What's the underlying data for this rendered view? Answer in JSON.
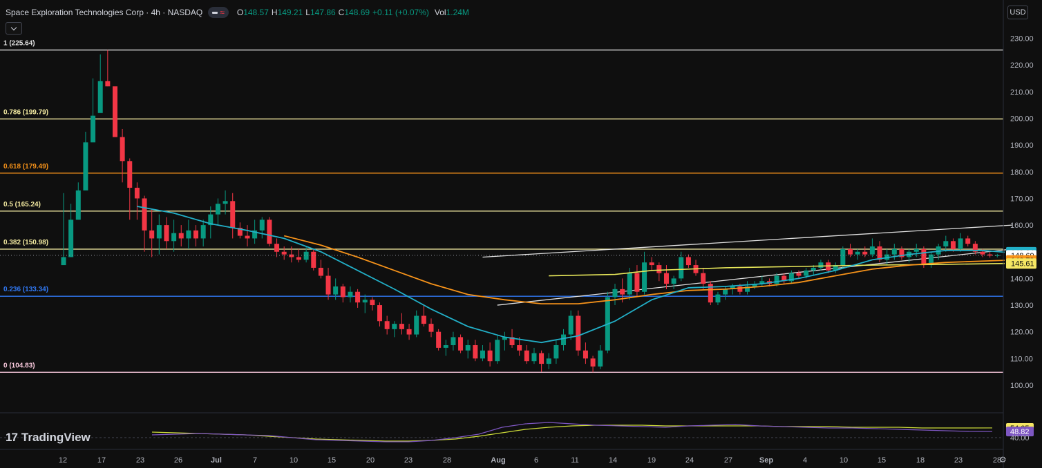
{
  "header": {
    "symbol": "Space Exploration Technologies Corp · 4h · NASDAQ",
    "open_label": "O",
    "open": "148.57",
    "high_label": "H",
    "high": "149.21",
    "low_label": "L",
    "low": "147.86",
    "close_label": "C",
    "close": "148.69",
    "change": "+0.11 (+0.07%)",
    "vol_label": "Vol",
    "volume": "1.24M"
  },
  "currency": "USD",
  "branding": {
    "logo": "17",
    "name": "TradingView"
  },
  "icons": {
    "collapse": "chevron-down-icon",
    "settings": "gear-icon",
    "indicator": "wave-icon",
    "series": "dash-icon"
  },
  "colors": {
    "up": "#089981",
    "down": "#f23645",
    "ema_fast": "#22b0c8",
    "ema_slow": "#f7931a",
    "sma": "#e8e85a",
    "rsi": "#7e57c2",
    "rsi_ma": "#cddc39"
  },
  "chart_data": {
    "type": "candlestick",
    "timeframe": "4h",
    "y_axis": {
      "min": 100,
      "max": 230,
      "ticks": [
        230,
        220,
        210,
        200,
        190,
        180,
        170,
        160,
        150,
        140,
        130,
        120,
        110,
        100
      ]
    },
    "x_axis": {
      "ticks": [
        "12",
        "17",
        "23",
        "26",
        "Jul",
        "7",
        "10",
        "15",
        "20",
        "23",
        "28",
        "Aug",
        "6",
        "11",
        "14",
        "19",
        "24",
        "27",
        "Sep",
        "4",
        "10",
        "15",
        "18",
        "23",
        "28"
      ]
    },
    "fib_levels": [
      {
        "label": "1 (225.64)",
        "value": 225.64,
        "color": "#e0e0e0"
      },
      {
        "label": "0.786 (199.79)",
        "value": 199.79,
        "color": "#f2e9a0"
      },
      {
        "label": "0.618 (179.49)",
        "value": 179.49,
        "color": "#f7931a"
      },
      {
        "label": "0.5 (165.24)",
        "value": 165.24,
        "color": "#f2e9a0"
      },
      {
        "label": "0.382 (150.98)",
        "value": 150.98,
        "color": "#f2e9a0"
      },
      {
        "label": "0.236 (133.34)",
        "value": 133.34,
        "color": "#3179f5"
      },
      {
        "label": "0 (104.83)",
        "value": 104.83,
        "color": "#f8c8dc"
      }
    ],
    "price_labels": [
      {
        "value": 149.84,
        "text": "149.84",
        "bg": "#22b0c8",
        "fg": "#0f0f0f"
      },
      {
        "value": 148.69,
        "text": "148.69",
        "bg": "#ffffff",
        "fg": "#0f0f0f"
      },
      {
        "value": 146.79,
        "text": "146.79",
        "bg": "#f7931a",
        "fg": "#0f0f0f"
      },
      {
        "value": 145.61,
        "text": "145.61",
        "bg": "#f5e663",
        "fg": "#0f0f0f"
      }
    ],
    "last_price": 148.69,
    "candles": [
      [
        145.0,
        172.0,
        148.0,
        148.0
      ],
      [
        148.0,
        168.0,
        148.0,
        162.0
      ],
      [
        162.0,
        176.0,
        165.0,
        173.0
      ],
      [
        173.0,
        195.0,
        175.0,
        191.0
      ],
      [
        191.0,
        215.0,
        200.0,
        201.0
      ],
      [
        202.0,
        224.0,
        208.0,
        214.0
      ],
      [
        214.0,
        225.64,
        212.0,
        212.0
      ],
      [
        212.0,
        210.0,
        193.0,
        193.0
      ],
      [
        193.0,
        196.0,
        176.0,
        184.0
      ],
      [
        184.0,
        185.0,
        162.0,
        174.0
      ],
      [
        174.0,
        176.0,
        162.0,
        170.0
      ],
      [
        170.0,
        171.0,
        150.0,
        158.0
      ],
      [
        158.0,
        166.0,
        148.0,
        155.0
      ],
      [
        155.0,
        164.0,
        149.0,
        160.0
      ],
      [
        160.0,
        163.0,
        151.0,
        154.0
      ],
      [
        154.0,
        162.0,
        150.0,
        157.0
      ],
      [
        157.0,
        160.0,
        152.0,
        155.0
      ],
      [
        155.0,
        162.0,
        151.0,
        158.0
      ],
      [
        158.0,
        160.0,
        152.0,
        155.0
      ],
      [
        155.0,
        162.0,
        152.0,
        160.0
      ],
      [
        160.0,
        167.0,
        155.0,
        164.0
      ],
      [
        164.0,
        170.0,
        160.0,
        168.0
      ],
      [
        168.0,
        173.0,
        164.0,
        169.0
      ],
      [
        169.0,
        172.0,
        155.0,
        159.0
      ],
      [
        159.0,
        161.0,
        155.0,
        156.0
      ],
      [
        156.0,
        160.0,
        152.0,
        155.0
      ],
      [
        155.0,
        162.0,
        153.0,
        158.0
      ],
      [
        158.0,
        163.0,
        155.0,
        162.0
      ],
      [
        162.0,
        163.0,
        152.0,
        153.0
      ],
      [
        153.0,
        155.0,
        148.0,
        150.0
      ],
      [
        150.0,
        152.0,
        147.0,
        149.0
      ],
      [
        149.0,
        152.0,
        146.0,
        148.0
      ],
      [
        148.0,
        151.0,
        146.0,
        147.0
      ],
      [
        147.0,
        152.0,
        146.0,
        150.0
      ],
      [
        150.0,
        151.0,
        143.0,
        144.0
      ],
      [
        144.0,
        147.0,
        140.0,
        141.0
      ],
      [
        141.0,
        144.0,
        132.0,
        134.0
      ],
      [
        134.0,
        140.0,
        132.0,
        137.0
      ],
      [
        137.0,
        138.0,
        131.0,
        133.0
      ],
      [
        133.0,
        137.0,
        131.0,
        135.0
      ],
      [
        135.0,
        136.0,
        129.0,
        131.0
      ],
      [
        131.0,
        134.0,
        127.0,
        132.0
      ],
      [
        132.0,
        133.0,
        128.0,
        130.0
      ],
      [
        130.0,
        131.0,
        122.0,
        124.0
      ],
      [
        124.0,
        126.0,
        119.0,
        121.0
      ],
      [
        121.0,
        124.0,
        118.0,
        123.0
      ],
      [
        123.0,
        127.0,
        119.0,
        121.0
      ],
      [
        121.0,
        123.0,
        117.0,
        119.0
      ],
      [
        119.0,
        128.0,
        118.0,
        126.0
      ],
      [
        126.0,
        130.0,
        122.0,
        123.0
      ],
      [
        123.0,
        125.0,
        118.0,
        120.0
      ],
      [
        120.0,
        121.0,
        113.0,
        114.0
      ],
      [
        114.0,
        117.0,
        111.0,
        115.0
      ],
      [
        115.0,
        120.0,
        113.0,
        118.0
      ],
      [
        118.0,
        119.0,
        112.0,
        113.0
      ],
      [
        113.0,
        117.0,
        110.0,
        115.0
      ],
      [
        115.0,
        117.0,
        109.0,
        110.0
      ],
      [
        110.0,
        115.0,
        109.0,
        113.0
      ],
      [
        113.0,
        116.0,
        107.0,
        109.0
      ],
      [
        109.0,
        119.0,
        108.0,
        117.0
      ],
      [
        117.0,
        120.0,
        113.0,
        118.0
      ],
      [
        118.0,
        121.0,
        114.0,
        115.0
      ],
      [
        115.0,
        118.0,
        111.0,
        113.0
      ],
      [
        113.0,
        115.0,
        108.0,
        109.0
      ],
      [
        109.0,
        114.0,
        108.0,
        112.0
      ],
      [
        112.0,
        113.0,
        105.0,
        108.0
      ],
      [
        108.0,
        112.0,
        106.0,
        110.0
      ],
      [
        110.0,
        117.0,
        108.0,
        115.0
      ],
      [
        115.0,
        121.0,
        113.0,
        119.0
      ],
      [
        119.0,
        128.0,
        117.0,
        126.0
      ],
      [
        126.0,
        128.0,
        111.0,
        113.0
      ],
      [
        113.0,
        116.0,
        108.0,
        110.0
      ],
      [
        110.0,
        111.0,
        104.83,
        107.0
      ],
      [
        107.0,
        115.0,
        106.0,
        113.0
      ],
      [
        113.0,
        135.0,
        112.0,
        133.0
      ],
      [
        133.0,
        138.0,
        130.0,
        136.0
      ],
      [
        136.0,
        140.0,
        131.0,
        134.0
      ],
      [
        134.0,
        144.0,
        132.0,
        142.0
      ],
      [
        142.0,
        145.0,
        133.0,
        135.0
      ],
      [
        135.0,
        150.0,
        134.0,
        146.0
      ],
      [
        146.0,
        148.0,
        143.0,
        145.0
      ],
      [
        145.0,
        146.0,
        139.0,
        142.0
      ],
      [
        142.0,
        145.0,
        136.0,
        138.0
      ],
      [
        138.0,
        141.0,
        136.0,
        140.0
      ],
      [
        140.0,
        150.0,
        139.0,
        148.0
      ],
      [
        148.0,
        149.0,
        144.0,
        145.0
      ],
      [
        145.0,
        147.0,
        141.0,
        142.0
      ],
      [
        142.0,
        144.0,
        136.0,
        138.0
      ],
      [
        138.0,
        139.0,
        130.0,
        131.0
      ],
      [
        131.0,
        135.0,
        130.0,
        134.0
      ],
      [
        134.0,
        137.0,
        132.0,
        136.0
      ],
      [
        136.0,
        138.0,
        134.0,
        137.0
      ],
      [
        137.0,
        138.0,
        134.0,
        135.0
      ],
      [
        135.0,
        139.0,
        134.0,
        137.0
      ],
      [
        137.0,
        139.0,
        136.0,
        138.0
      ],
      [
        138.0,
        141.0,
        137.0,
        139.0
      ],
      [
        139.0,
        140.0,
        137.0,
        138.0
      ],
      [
        138.0,
        142.0,
        137.0,
        141.0
      ],
      [
        141.0,
        142.0,
        138.0,
        139.0
      ],
      [
        139.0,
        143.0,
        138.0,
        142.0
      ],
      [
        142.0,
        143.0,
        140.0,
        141.0
      ],
      [
        141.0,
        144.0,
        140.0,
        143.0
      ],
      [
        143.0,
        145.0,
        141.0,
        144.0
      ],
      [
        144.0,
        147.0,
        143.0,
        146.0
      ],
      [
        146.0,
        147.0,
        142.0,
        143.0
      ],
      [
        143.0,
        146.0,
        142.0,
        145.0
      ],
      [
        145.0,
        152.0,
        144.0,
        151.0
      ],
      [
        151.0,
        153.0,
        148.0,
        149.0
      ],
      [
        149.0,
        151.0,
        147.0,
        150.0
      ],
      [
        150.0,
        152.0,
        148.0,
        149.0
      ],
      [
        149.0,
        155.0,
        148.0,
        152.0
      ],
      [
        152.0,
        154.0,
        146.0,
        147.0
      ],
      [
        147.0,
        151.0,
        145.0,
        149.0
      ],
      [
        149.0,
        153.0,
        147.0,
        151.0
      ],
      [
        151.0,
        152.0,
        147.0,
        148.0
      ],
      [
        148.0,
        151.0,
        146.0,
        150.0
      ],
      [
        150.0,
        153.0,
        148.0,
        151.0
      ],
      [
        151.0,
        152.0,
        144.0,
        145.0
      ],
      [
        145.0,
        150.0,
        144.0,
        149.0
      ],
      [
        149.0,
        153.0,
        147.0,
        152.0
      ],
      [
        152.0,
        156.0,
        150.0,
        154.0
      ],
      [
        154.0,
        155.0,
        150.0,
        151.0
      ],
      [
        151.0,
        157.0,
        150.0,
        155.0
      ],
      [
        155.0,
        156.0,
        152.0,
        153.0
      ],
      [
        153.0,
        154.0,
        149.0,
        150.0
      ],
      [
        150.0,
        151.0,
        148.0,
        149.0
      ],
      [
        149.0,
        150.0,
        147.8,
        148.57
      ],
      [
        148.57,
        149.21,
        147.86,
        148.69
      ]
    ],
    "ema_fast": [
      [
        10,
        167.0
      ],
      [
        15,
        164.5
      ],
      [
        20,
        160.5
      ],
      [
        25,
        158.0
      ],
      [
        30,
        155.0
      ],
      [
        35,
        150.0
      ],
      [
        40,
        143.0
      ],
      [
        45,
        136.0
      ],
      [
        50,
        128.5
      ],
      [
        55,
        122.0
      ],
      [
        60,
        118.0
      ],
      [
        65,
        116.0
      ],
      [
        70,
        118.5
      ],
      [
        75,
        124.0
      ],
      [
        80,
        132.0
      ],
      [
        85,
        136.5
      ],
      [
        90,
        137.0
      ],
      [
        95,
        138.0
      ],
      [
        100,
        140.0
      ],
      [
        105,
        143.0
      ],
      [
        110,
        147.0
      ],
      [
        115,
        149.0
      ],
      [
        120,
        150.5
      ],
      [
        125,
        150.5
      ],
      [
        128,
        149.84
      ]
    ],
    "ema_slow": [
      [
        30,
        156.0
      ],
      [
        35,
        152.5
      ],
      [
        40,
        148.0
      ],
      [
        45,
        143.0
      ],
      [
        50,
        138.0
      ],
      [
        55,
        134.0
      ],
      [
        60,
        132.0
      ],
      [
        65,
        130.5
      ],
      [
        70,
        130.5
      ],
      [
        75,
        132.0
      ],
      [
        80,
        134.0
      ],
      [
        85,
        135.5
      ],
      [
        90,
        136.0
      ],
      [
        95,
        137.0
      ],
      [
        100,
        138.5
      ],
      [
        105,
        141.0
      ],
      [
        110,
        143.5
      ],
      [
        115,
        145.0
      ],
      [
        120,
        146.0
      ],
      [
        125,
        146.5
      ],
      [
        128,
        146.79
      ]
    ],
    "sma": [
      [
        66,
        141.0
      ],
      [
        75,
        141.5
      ],
      [
        80,
        143.0
      ],
      [
        90,
        144.0
      ],
      [
        100,
        144.5
      ],
      [
        110,
        145.0
      ],
      [
        120,
        145.3
      ],
      [
        128,
        145.61
      ]
    ],
    "trendlines": [
      {
        "from": [
          57,
          148.0
        ],
        "to": [
          129,
          160.0
        ],
        "color": "#e0e0e0"
      },
      {
        "from": [
          59,
          130.0
        ],
        "to": [
          129,
          151.0
        ],
        "color": "#e0e0e0"
      }
    ],
    "rsi": {
      "value": "48.82",
      "ma_value": "54.05",
      "values": [
        44,
        45,
        46,
        45,
        44,
        43,
        40,
        37,
        36,
        35,
        34,
        34,
        36,
        40,
        45,
        55,
        60,
        62,
        60,
        58,
        57,
        56,
        55,
        57,
        58,
        59,
        57,
        56,
        55,
        54,
        54,
        53,
        52,
        51,
        50,
        49,
        48.82
      ],
      "ma_values": [
        48,
        47,
        46,
        45,
        44,
        42,
        40,
        38,
        37,
        36,
        35,
        35,
        36,
        38,
        42,
        47,
        52,
        55,
        57,
        58,
        58,
        58,
        57,
        57,
        57,
        57,
        57,
        56,
        56,
        56,
        55,
        55,
        55,
        54,
        54,
        54,
        54.05
      ]
    },
    "rsi_axis": {
      "ticks": [
        "40.00"
      ]
    }
  }
}
